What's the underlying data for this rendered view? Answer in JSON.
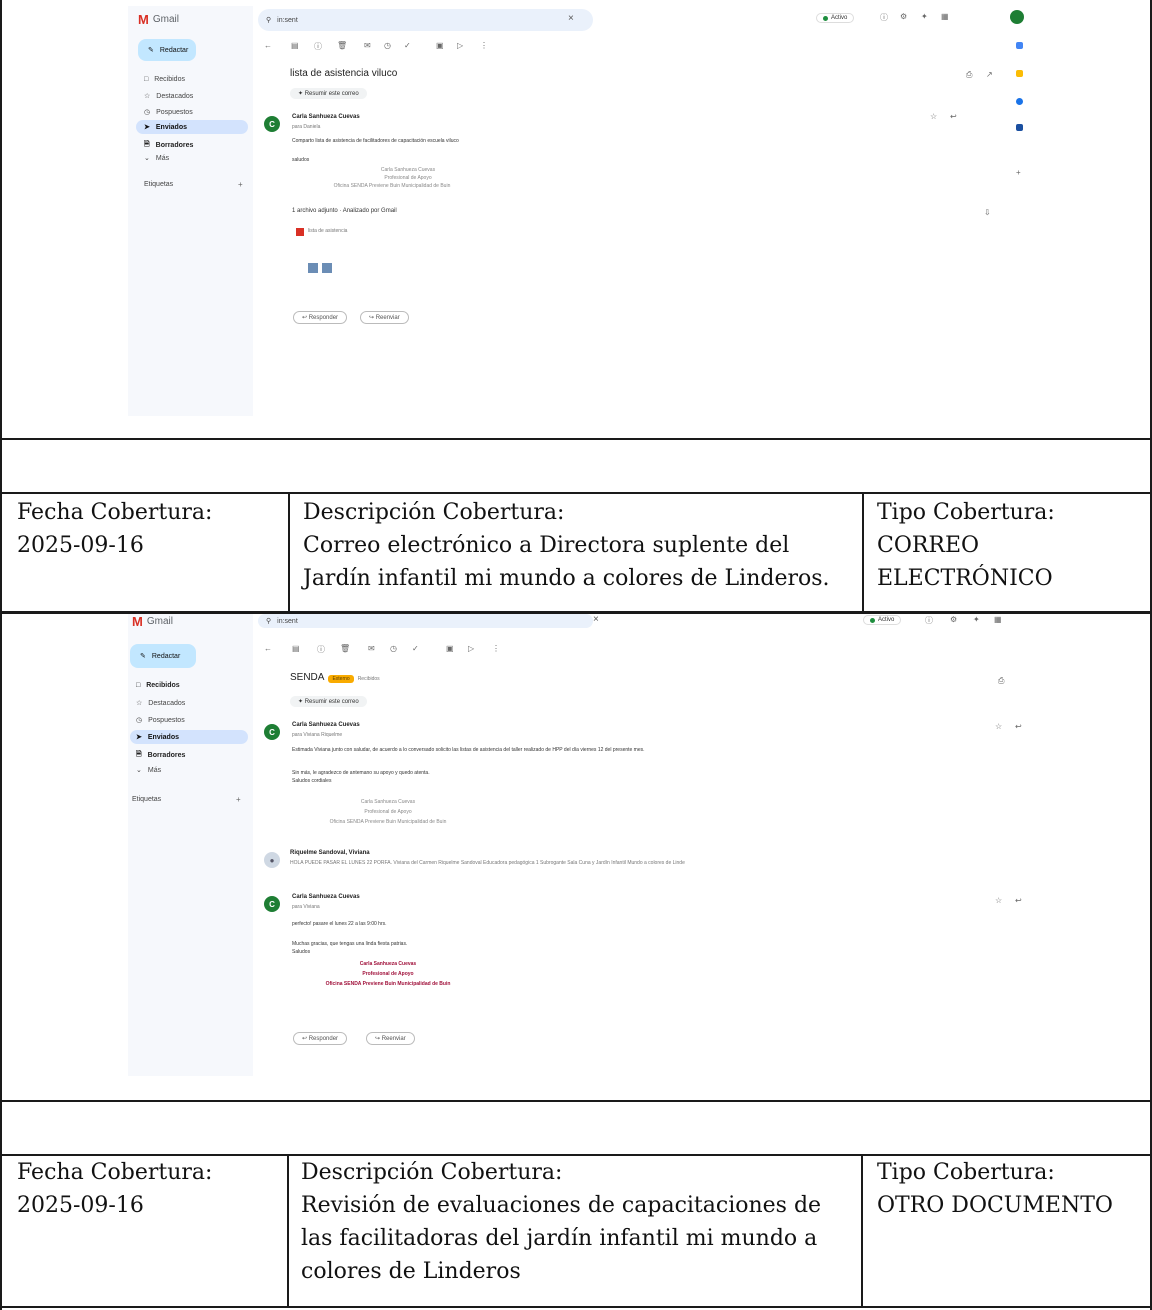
{
  "sections": [
    {
      "fecha_label": "Fecha Cobertura:",
      "fecha_value": "2025-09-16",
      "descripcion_label": "Descripción Cobertura:",
      "descripcion_lines": [
        "Correo electrónico a Directora suplente del",
        "Jardín infantil mi mundo a colores de Linderos."
      ],
      "tipo_label": "Tipo Cobertura:",
      "tipo_lines": [
        "CORREO",
        "ELECTRÓNICO"
      ]
    },
    {
      "fecha_label": "Fecha Cobertura:",
      "fecha_value": "2025-09-16",
      "descripcion_label": "Descripción Cobertura:",
      "descripcion_lines": [
        "Revisión de evaluaciones de capacitaciones de",
        "las facilitadoras del jardín infantil mi mundo a",
        "colores de Linderos"
      ],
      "tipo_label": "Tipo Cobertura:",
      "tipo_lines": [
        "OTRO DOCUMENTO"
      ]
    }
  ],
  "screenshot1": {
    "app_name": "Gmail",
    "search_value": "in:sent",
    "active_status": "Activo",
    "compose_label": "Redactar",
    "nav": [
      "Recibidos",
      "Destacados",
      "Pospuestos",
      "Enviados",
      "Borradores",
      "Más"
    ],
    "labels_heading": "Etiquetas",
    "subject": "lista de asistencia viluco",
    "summarize": "Resumir este correo",
    "sender": "Carla Sanhueza Cuevas",
    "to_line": "para Daniela",
    "body_line": "Comparto lista de asistencia de facilitadores de capacitación escuela viluco",
    "greeting": "saludos",
    "signature": [
      "Carla Sanhueza Cuevas",
      "Profesional de Apoyo",
      "Oficina SENDA Previene Buin Municipalidad de Buin"
    ],
    "attachments_line": "1 archivo adjunto · Analizado por Gmail",
    "attachment_name": "lista de asistencia",
    "reply": "Responder",
    "forward": "Reenviar"
  },
  "screenshot2": {
    "app_name": "Gmail",
    "search_value": "in:sent",
    "active_status": "Activo",
    "compose_label": "Redactar",
    "nav": [
      "Recibidos",
      "Destacados",
      "Pospuestos",
      "Enviados",
      "Borradores",
      "Más"
    ],
    "labels_heading": "Etiquetas",
    "subject": "SENDA",
    "tag": "Externo",
    "inbox_tag": "Recibidos",
    "summarize": "Resumir este correo",
    "msg1_sender": "Carla Sanhueza Cuevas",
    "msg1_to": "para Viviana Riquelme",
    "msg1_body": "Estimada Viviana junto con saludar, de acuerdo a lo conversado solicito las listas de asistencia del taller realizado de HPP del día viernes 12 del presente mes.",
    "msg1_body2": "Sin más, le agradezco de antemano su apoyo y quedo atenta.",
    "msg1_closing": "Saludos cordiales",
    "msg2_sender": "Riquelme Sandoval, Viviana",
    "msg2_preview": "HOLA PUEDE PASAR EL LUNES 22 PORFA. Viviana del Carmen Riquelme Sandoval Educadora pedagógica 1 Subrogante Sala Cuna y Jardín Infantil Mundo a colores de Linde",
    "msg3_sender": "Carla Sanhueza Cuevas",
    "msg3_to": "para Viviana",
    "msg3_body": "perfecto! pasare el lunes 22 a las 9:00 hrs.",
    "msg3_body2": "Muchas gracias, que tengas una linda fiesta patrias.",
    "msg3_closing": "Saludos",
    "signature": [
      "Carla Sanhueza Cuevas",
      "Profesional de Apoyo",
      "Oficina SENDA Previene Buin Municipalidad de Buin"
    ],
    "reply": "Responder",
    "forward": "Reenviar"
  }
}
